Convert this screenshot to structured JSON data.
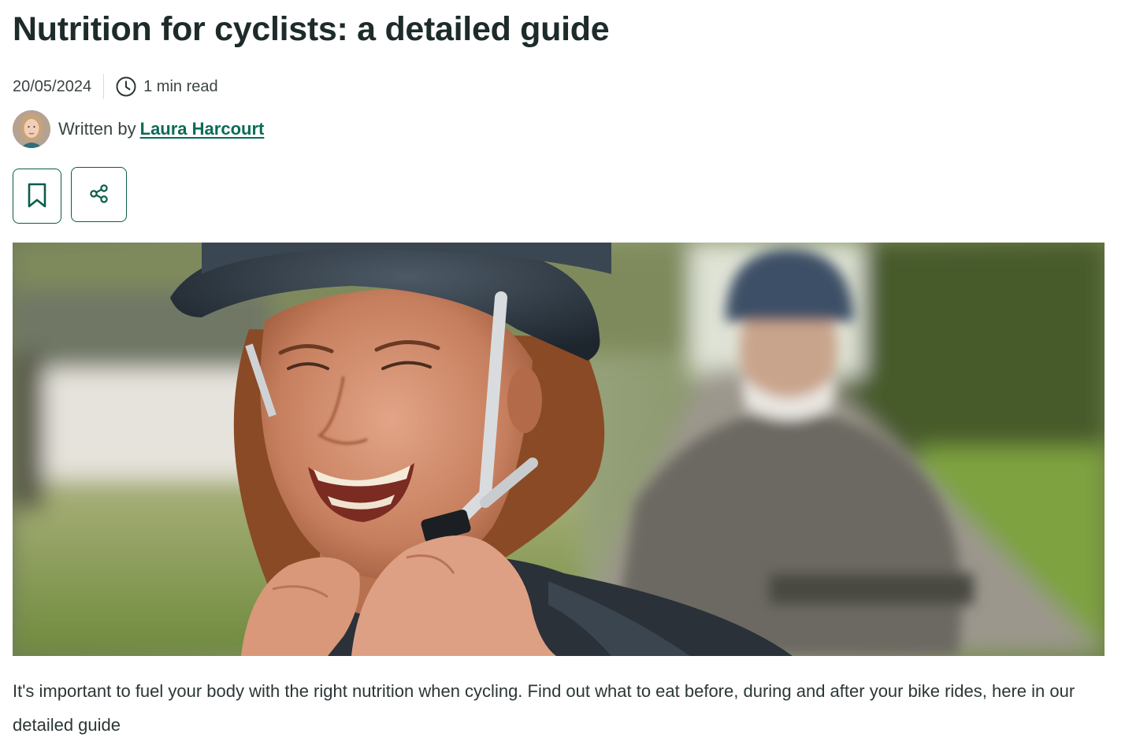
{
  "article": {
    "title": "Nutrition for cyclists: a detailed guide",
    "date": "20/05/2024",
    "read_time": "1 min read",
    "written_by": "Written by",
    "author_name": "Laura Harcourt",
    "intro": "It's important to fuel your body with the right nutrition when cycling. Find out what to eat before, during and after your bike rides, here in our detailed guide"
  },
  "icons": {
    "clock": "clock-icon",
    "bookmark": "bookmark-icon",
    "share": "share-icon"
  },
  "colors": {
    "accent": "#0b6b58",
    "button_border": "#0b5c4c",
    "title": "#1d2b2a",
    "text": "#3a4444"
  }
}
